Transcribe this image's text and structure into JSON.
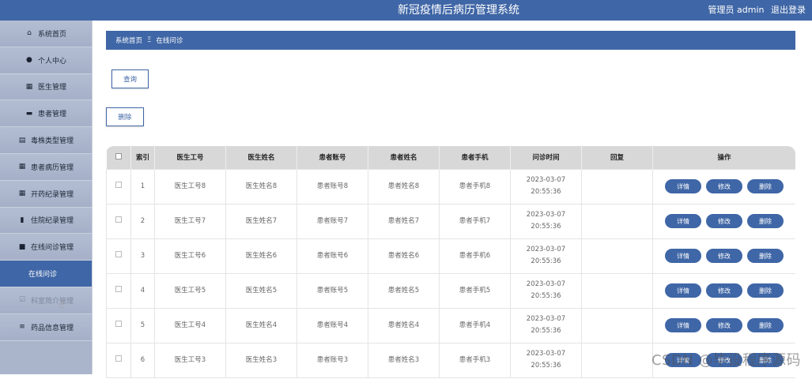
{
  "header": {
    "title": "新冠疫情后病历管理系统",
    "user_label": "管理员 admin",
    "logout_label": "退出登录"
  },
  "sidebar": {
    "items": [
      {
        "label": "系统首页",
        "icon": "home-icon"
      },
      {
        "label": "个人中心",
        "icon": "user-icon"
      },
      {
        "label": "医生管理",
        "icon": "grid-icon"
      },
      {
        "label": "患者管理",
        "icon": "ticket-icon"
      },
      {
        "label": "毒株类型管理",
        "icon": "clipboard-icon"
      },
      {
        "label": "患者病历管理",
        "icon": "grid-icon"
      },
      {
        "label": "开药纪录管理",
        "icon": "grid-icon"
      },
      {
        "label": "住院纪录管理",
        "icon": "bar-chart-icon"
      },
      {
        "label": "在线问诊管理",
        "icon": "briefcase-icon"
      },
      {
        "label": "在线问诊",
        "icon": ""
      },
      {
        "label": "科室简介管理",
        "icon": "checkbox-icon"
      },
      {
        "label": "药品信息管理",
        "icon": "list-icon"
      }
    ]
  },
  "breadcrumb": {
    "home": "系统首页",
    "separator": "Ξ",
    "current": "在线问诊"
  },
  "toolbar": {
    "query_label": "查询",
    "delete_label": "删除"
  },
  "table": {
    "columns": [
      "",
      "索引",
      "医生工号",
      "医生姓名",
      "患者账号",
      "患者姓名",
      "患者手机",
      "问诊时间",
      "回复",
      "操作"
    ],
    "rows": [
      {
        "index": "1",
        "doctor_id": "医生工号8",
        "doctor_name": "医生姓名8",
        "patient_account": "患者账号8",
        "patient_name": "患者姓名8",
        "patient_phone": "患者手机8",
        "time": "2023-03-07 20:55:36",
        "reply": ""
      },
      {
        "index": "2",
        "doctor_id": "医生工号7",
        "doctor_name": "医生姓名7",
        "patient_account": "患者账号7",
        "patient_name": "患者姓名7",
        "patient_phone": "患者手机7",
        "time": "2023-03-07 20:55:36",
        "reply": ""
      },
      {
        "index": "3",
        "doctor_id": "医生工号6",
        "doctor_name": "医生姓名6",
        "patient_account": "患者账号6",
        "patient_name": "患者姓名6",
        "patient_phone": "患者手机6",
        "time": "2023-03-07 20:55:36",
        "reply": ""
      },
      {
        "index": "4",
        "doctor_id": "医生工号5",
        "doctor_name": "医生姓名5",
        "patient_account": "患者账号5",
        "patient_name": "患者姓名5",
        "patient_phone": "患者手机5",
        "time": "2023-03-07 20:55:36",
        "reply": ""
      },
      {
        "index": "5",
        "doctor_id": "医生工号4",
        "doctor_name": "医生姓名4",
        "patient_account": "患者账号4",
        "patient_name": "患者姓名4",
        "patient_phone": "患者手机4",
        "time": "2023-03-07 20:55:36",
        "reply": ""
      },
      {
        "index": "6",
        "doctor_id": "医生工号3",
        "doctor_name": "医生姓名3",
        "patient_account": "患者账号3",
        "patient_name": "患者姓名3",
        "patient_phone": "患者手机3",
        "time": "2023-03-07 20:55:36",
        "reply": ""
      }
    ],
    "actions": [
      "详情",
      "修改",
      "删除"
    ]
  },
  "watermark": "CSDN @毕设程序源码",
  "colors": {
    "primary": "#3f66a6",
    "sidebar": "#aab5cc"
  }
}
